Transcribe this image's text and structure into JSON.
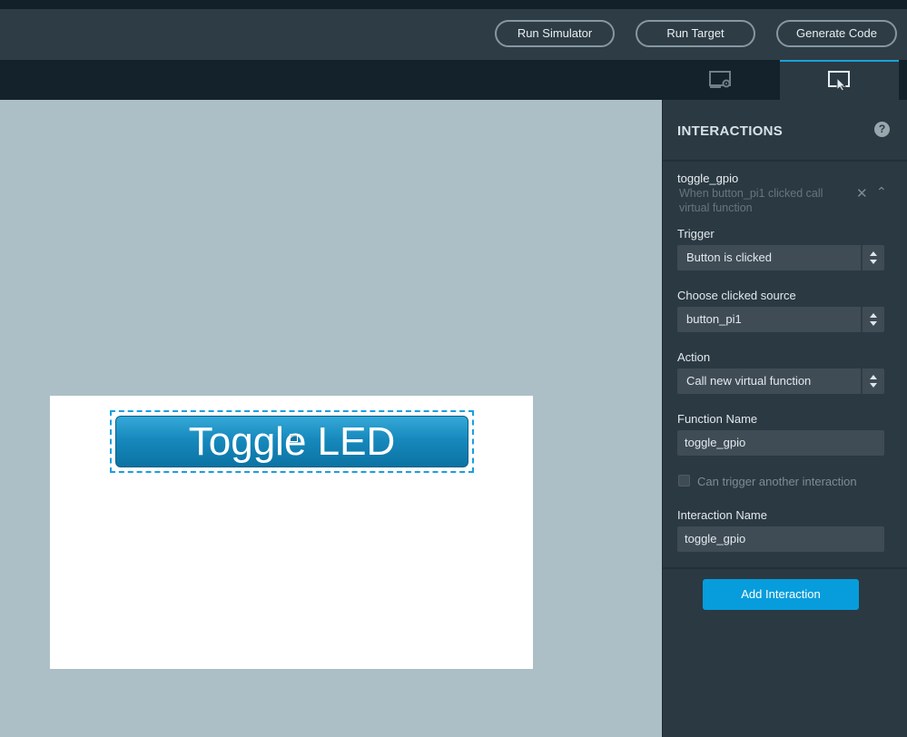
{
  "toolbar": {
    "run_simulator": "Run Simulator",
    "run_target": "Run Target",
    "generate_code": "Generate Code"
  },
  "tabs": [
    {
      "icon": "display-settings-icon",
      "active": false
    },
    {
      "icon": "interaction-pointer-icon",
      "active": true
    }
  ],
  "canvas": {
    "button_label": "Toggle LED"
  },
  "panel": {
    "title": "INTERACTIONS",
    "help_glyph": "?",
    "interaction": {
      "name": "toggle_gpio",
      "description": "When button_pi1 clicked call virtual function"
    },
    "trigger": {
      "label": "Trigger",
      "value": "Button is clicked"
    },
    "source": {
      "label": "Choose clicked source",
      "value": "button_pi1"
    },
    "action": {
      "label": "Action",
      "value": "Call new virtual function"
    },
    "function_name": {
      "label": "Function Name",
      "value": "toggle_gpio"
    },
    "chain": {
      "label": "Can trigger another interaction",
      "checked": false
    },
    "interaction_name": {
      "label": "Interaction Name",
      "value": "toggle_gpio"
    },
    "add_button": "Add Interaction"
  },
  "colors": {
    "accent": "#079ddc",
    "panel_bg": "#2b3942",
    "canvas_bg": "#adbfc6",
    "toolbar_bg": "#2e3c45"
  }
}
